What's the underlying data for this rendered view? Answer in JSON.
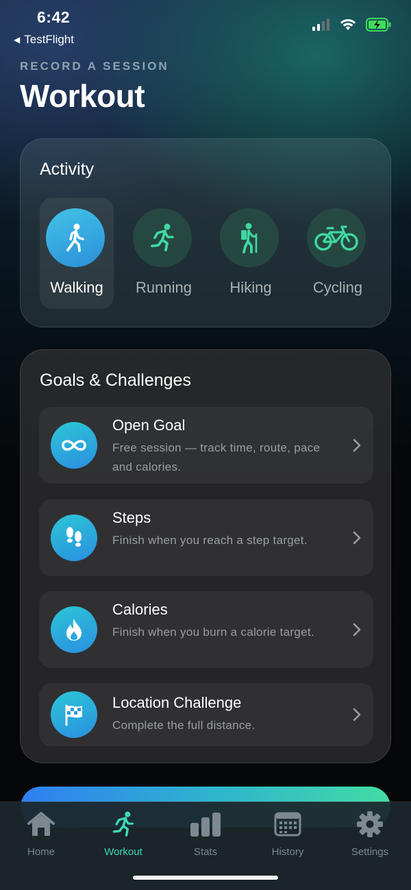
{
  "status_bar": {
    "time": "6:42",
    "back_app": "TestFlight"
  },
  "header": {
    "eyebrow": "RECORD A SESSION",
    "title": "Workout"
  },
  "activity": {
    "title": "Activity",
    "items": [
      {
        "label": "Walking",
        "icon": "walking-icon",
        "selected": true
      },
      {
        "label": "Running",
        "icon": "running-icon",
        "selected": false
      },
      {
        "label": "Hiking",
        "icon": "hiking-icon",
        "selected": false
      },
      {
        "label": "Cycling",
        "icon": "cycling-icon",
        "selected": false
      }
    ]
  },
  "goals": {
    "title": "Goals & Challenges",
    "items": [
      {
        "name": "Open Goal",
        "description": "Free session — track time, route, pace and calories.",
        "icon": "infinity-icon"
      },
      {
        "name": "Steps",
        "description": "Finish when you reach a step target.",
        "icon": "footprints-icon"
      },
      {
        "name": "Calories",
        "description": "Finish when you burn a calorie target.",
        "icon": "flame-icon"
      },
      {
        "name": "Location Challenge",
        "description": "Complete the full distance.",
        "icon": "checkered-flag-icon"
      }
    ]
  },
  "tab_bar": {
    "tabs": [
      {
        "label": "Home",
        "icon": "house-icon",
        "active": false
      },
      {
        "label": "Workout",
        "icon": "running-icon",
        "active": true
      },
      {
        "label": "Stats",
        "icon": "bar-chart-icon",
        "active": false
      },
      {
        "label": "History",
        "icon": "calendar-icon",
        "active": false
      },
      {
        "label": "Settings",
        "icon": "gear-icon",
        "active": false
      }
    ]
  },
  "colors": {
    "accent": "#3fd9b4",
    "selected_gradient_start": "#43c3e8",
    "icon_green": "#3fd9a0"
  }
}
